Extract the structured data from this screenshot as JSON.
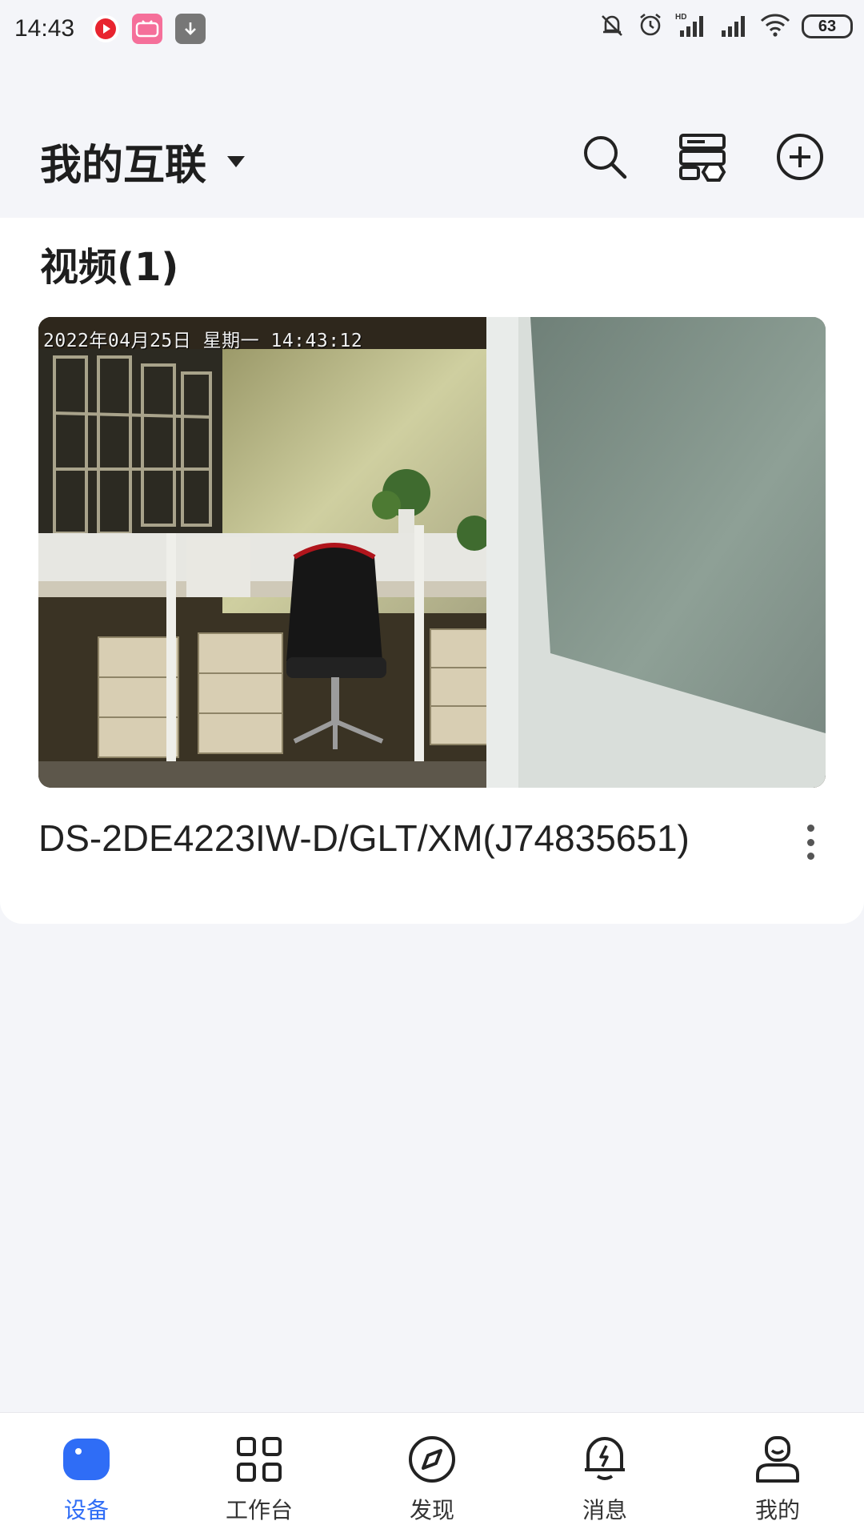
{
  "status_bar": {
    "time": "14:43",
    "battery": "63",
    "notif_icons": [
      "video-app-icon",
      "bilibili-icon",
      "download-icon"
    ],
    "status_icons": [
      "mute-icon",
      "alarm-icon",
      "hd-signal-icon",
      "signal-icon",
      "wifi-icon",
      "battery-icon"
    ]
  },
  "header": {
    "title": "我的互联",
    "actions": [
      "search-icon",
      "device-manage-icon",
      "add-icon"
    ]
  },
  "section": {
    "title": "视频(1)"
  },
  "device": {
    "osd": "2022年04月25日  星期一  14:43:12",
    "name": "DS-2DE4223IW-D/GLT/XM(J74835651)"
  },
  "nav": {
    "items": [
      {
        "label": "设备",
        "icon": "device-icon",
        "active": true
      },
      {
        "label": "工作台",
        "icon": "workbench-icon",
        "active": false
      },
      {
        "label": "发现",
        "icon": "compass-icon",
        "active": false
      },
      {
        "label": "消息",
        "icon": "bell-icon",
        "active": false
      },
      {
        "label": "我的",
        "icon": "profile-icon",
        "active": false
      }
    ]
  },
  "colors": {
    "accent": "#2f6df6",
    "background": "#f4f5f9"
  }
}
